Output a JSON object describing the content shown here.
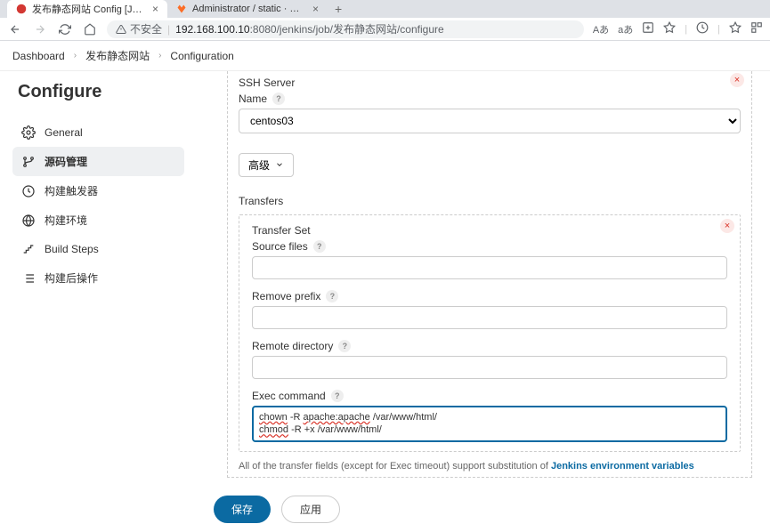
{
  "browser": {
    "tabs": [
      {
        "title": "发布静态网站 Config [Jenkins]",
        "active": true
      },
      {
        "title": "Administrator / static · GitLab",
        "active": false
      }
    ],
    "url_warning": "不安全",
    "url_host": "192.168.100.10",
    "url_port": ":8080",
    "url_path": "/jenkins/job/发布静态网站/configure",
    "toolbar_az": "Aあ",
    "toolbar_aa": "aあ"
  },
  "breadcrumb": {
    "items": [
      "Dashboard",
      "发布静态网站",
      "Configuration"
    ]
  },
  "page": {
    "title": "Configure"
  },
  "sidebar": {
    "items": [
      {
        "label": "General",
        "icon": "gear"
      },
      {
        "label": "源码管理",
        "icon": "branch",
        "active": true
      },
      {
        "label": "构建触发器",
        "icon": "clock"
      },
      {
        "label": "构建环境",
        "icon": "globe"
      },
      {
        "label": "Build Steps",
        "icon": "steps"
      },
      {
        "label": "构建后操作",
        "icon": "list"
      }
    ]
  },
  "form": {
    "ssh_server_label": "SSH Server",
    "name_label": "Name",
    "name_value": "centos03",
    "advanced_label": "高级",
    "transfers_label": "Transfers",
    "transfer_set_label": "Transfer Set",
    "source_files_label": "Source files",
    "source_files_value": "",
    "remove_prefix_label": "Remove prefix",
    "remove_prefix_value": "",
    "remote_directory_label": "Remote directory",
    "remote_directory_value": "",
    "exec_command_label": "Exec command",
    "exec_command_line1_cmd": "chown",
    "exec_command_line1_rest1": " -R ",
    "exec_command_line1_usr": "apache:apache",
    "exec_command_line1_rest2": " /var/www/html/",
    "exec_command_line2_cmd": "chmod",
    "exec_command_line2_rest": " -R +x /var/www/html/",
    "hint_prefix": "All of the transfer fields (except for Exec timeout) support substitution of ",
    "hint_link": "Jenkins environment variables"
  },
  "actions": {
    "save": "保存",
    "apply": "应用"
  }
}
